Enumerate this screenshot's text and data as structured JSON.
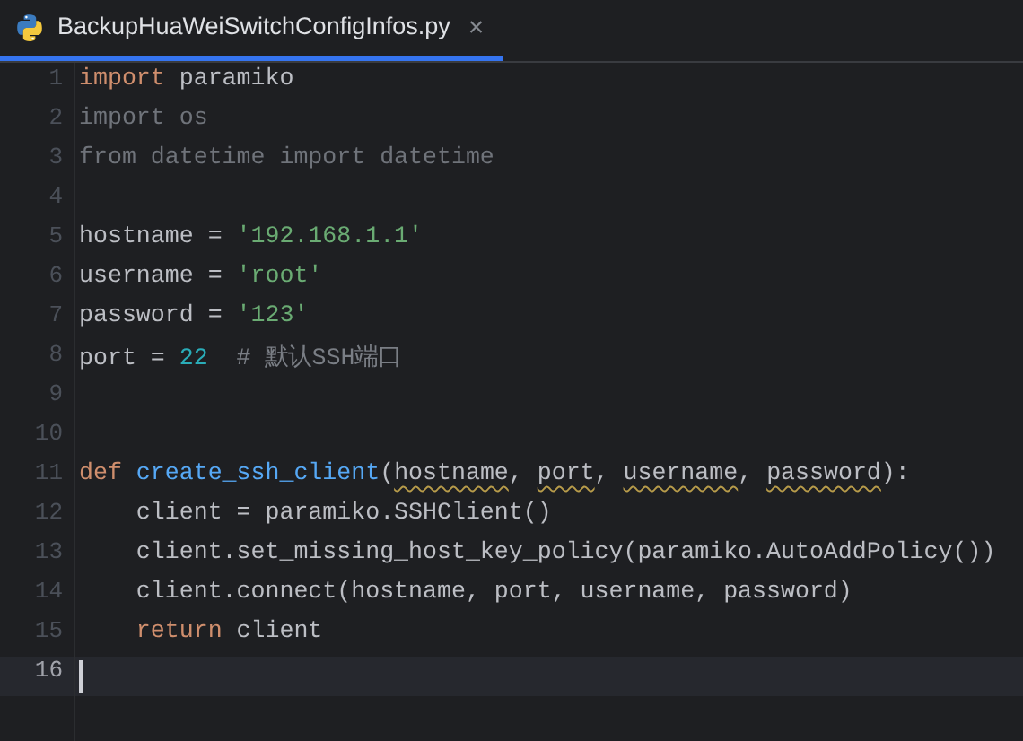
{
  "tabs": [
    {
      "label": "BackupHuaWeiSwitchConfigInfos.py",
      "selected": true,
      "close": "×"
    }
  ],
  "editor": {
    "lines": [
      {
        "number": "1",
        "current": false,
        "tokens": [
          {
            "text": "import",
            "kind": "keyword"
          },
          {
            "text": " paramiko",
            "kind": "plain"
          }
        ]
      },
      {
        "number": "2",
        "current": false,
        "tokens": [
          {
            "text": "import os",
            "kind": "unused"
          }
        ]
      },
      {
        "number": "3",
        "current": false,
        "tokens": [
          {
            "text": "from datetime import datetime",
            "kind": "unused"
          }
        ]
      },
      {
        "number": "4",
        "current": false
      },
      {
        "number": "5",
        "current": false,
        "tokens": [
          {
            "text": "hostname = ",
            "kind": "plain"
          },
          {
            "text": "'192.168.1.1'",
            "kind": "string"
          }
        ]
      },
      {
        "number": "6",
        "current": false,
        "tokens": [
          {
            "text": "username = ",
            "kind": "plain"
          },
          {
            "text": "'root'",
            "kind": "string"
          }
        ]
      },
      {
        "number": "7",
        "current": false,
        "tokens": [
          {
            "text": "password = ",
            "kind": "plain"
          },
          {
            "text": "'123'",
            "kind": "string"
          }
        ]
      },
      {
        "number": "8",
        "current": false,
        "tokens": [
          {
            "text": "port = ",
            "kind": "plain"
          },
          {
            "text": "22",
            "kind": "number"
          },
          {
            "text": "  # 默认SSH端口",
            "kind": "comment"
          }
        ]
      },
      {
        "number": "9",
        "current": false
      },
      {
        "number": "10",
        "current": false
      },
      {
        "number": "11",
        "current": false,
        "tokens": [
          {
            "text": "def ",
            "kind": "keyword"
          },
          {
            "text": "create_ssh_client",
            "kind": "function"
          },
          {
            "text": "(",
            "kind": "plain"
          },
          {
            "text": "hostname",
            "kind": "warning"
          },
          {
            "text": ", ",
            "kind": "plain"
          },
          {
            "text": "port",
            "kind": "warning"
          },
          {
            "text": ", ",
            "kind": "plain"
          },
          {
            "text": "username",
            "kind": "warning"
          },
          {
            "text": ", ",
            "kind": "plain"
          },
          {
            "text": "password",
            "kind": "warning"
          },
          {
            "text": "):",
            "kind": "plain"
          }
        ]
      },
      {
        "number": "12",
        "current": false,
        "tokens": [
          {
            "text": "    client = paramiko.SSHClient()",
            "kind": "plain"
          }
        ]
      },
      {
        "number": "13",
        "current": false,
        "tokens": [
          {
            "text": "    client.set_missing_host_key_policy(paramiko.AutoAddPolicy())",
            "kind": "plain"
          }
        ]
      },
      {
        "number": "14",
        "current": false,
        "tokens": [
          {
            "text": "    client.connect(hostname, port, username, password)",
            "kind": "plain"
          }
        ]
      },
      {
        "number": "15",
        "current": false,
        "tokens": [
          {
            "text": "    return",
            "kind": "keyword"
          },
          {
            "text": " client",
            "kind": "plain"
          }
        ]
      },
      {
        "number": "16",
        "current": true
      }
    ]
  }
}
